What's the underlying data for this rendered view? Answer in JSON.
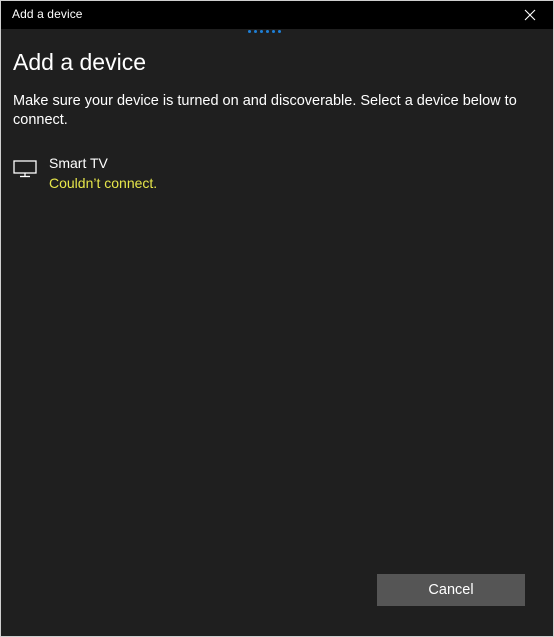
{
  "window": {
    "title": "Add a device"
  },
  "dialog": {
    "heading": "Add a device",
    "description": "Make sure your device is turned on and discoverable. Select a device below to connect.",
    "progress_color": "#1e7fd6"
  },
  "devices": [
    {
      "name": "Smart TV",
      "status": "Couldn’t connect.",
      "icon": "monitor-icon",
      "status_color": "#e6e64a"
    }
  ],
  "footer": {
    "cancel_label": "Cancel"
  }
}
